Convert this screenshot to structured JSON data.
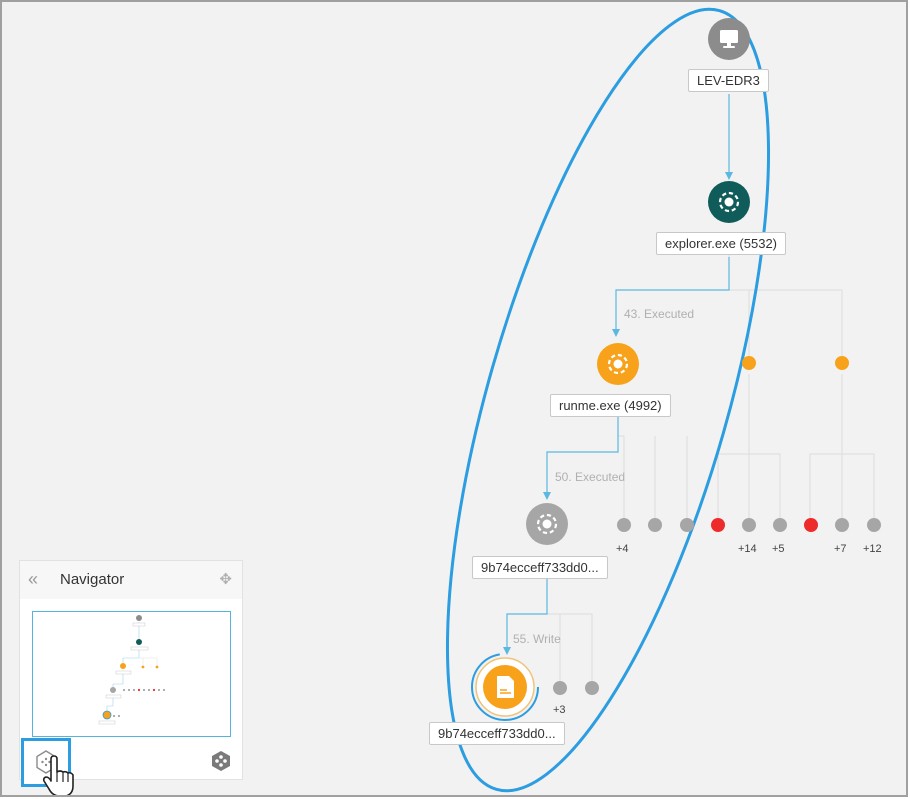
{
  "nodes": {
    "host": {
      "label": "LEV-EDR3",
      "icon": "monitor-icon",
      "color": "#8c8c8c"
    },
    "explorer": {
      "label": "explorer.exe (5532)",
      "icon": "process-icon",
      "color": "#0f5c5a"
    },
    "runme": {
      "label": "runme.exe (4992)",
      "icon": "process-icon",
      "color": "#f7a21a"
    },
    "child": {
      "label": "9b74ecceff733dd0...",
      "icon": "process-icon",
      "color": "#8c8c8c"
    },
    "file": {
      "label": "9b74ecceff733dd0...",
      "icon": "document-icon",
      "color": "#f7a21a"
    }
  },
  "edges": {
    "runme": "43. Executed",
    "child": "50. Executed",
    "file": "55. Write"
  },
  "collapsed_counts": {
    "a": "+4",
    "b": "+14",
    "c": "+5",
    "d": "+7",
    "e": "+12",
    "f": "+3"
  },
  "navigator": {
    "title": "Navigator",
    "collapse_icon": "double-chevron-left-icon",
    "move_icon": "move-icon",
    "fit_icon": "fit-graph-icon",
    "layout_icon": "layout-icon"
  },
  "colors": {
    "highlight": "#2b9de0",
    "edge": "#5bb8e0",
    "inactive_edge": "#dcdcdc",
    "orange": "#f7a21a",
    "red": "#ee2b2b",
    "grey_node": "#a6a6a6",
    "dark_teal": "#0f5c5a"
  }
}
